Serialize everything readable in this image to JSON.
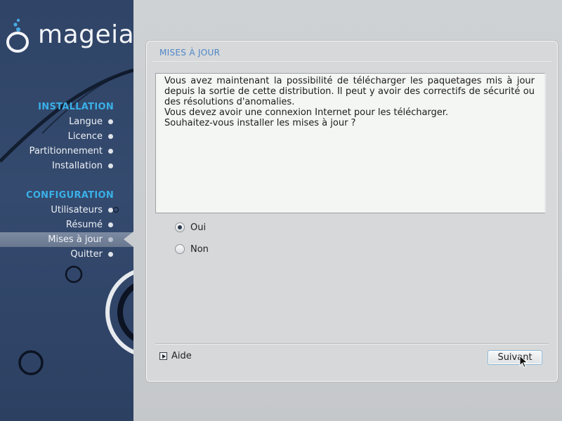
{
  "app": {
    "brand": "mageia"
  },
  "sidebar": {
    "sections": [
      {
        "title": "INSTALLATION",
        "items": [
          "Langue",
          "Licence",
          "Partitionnement",
          "Installation"
        ]
      },
      {
        "title": "CONFIGURATION",
        "items": [
          "Utilisateurs",
          "Résumé",
          "Mises à jour",
          "Quitter"
        ]
      }
    ],
    "active_item": "Mises à jour"
  },
  "panel": {
    "title": "MISES À JOUR",
    "message_lines": [
      "Vous avez maintenant la possibilité de télécharger les paquetages mis à jour depuis la sortie de cette distribution. Il peut y avoir des correctifs de sécurité ou des résolutions d'anomalies.",
      "Vous devez avoir une connexion Internet pour les télécharger.",
      "Souhaitez-vous installer les mises à jour ?"
    ],
    "options": [
      {
        "label": "Oui",
        "selected": true
      },
      {
        "label": "Non",
        "selected": false
      }
    ],
    "help_label": "Aide",
    "next_label": "Suivant"
  },
  "colors": {
    "sidebar_bg": "#31476b",
    "section_title": "#3ab0e8",
    "panel_title": "#4f86c6",
    "button_border": "#8bb8d6"
  },
  "icons": {
    "help": "triangle-right-icon",
    "cursor": "mouse-pointer-icon",
    "logo": "mageia-cauldron-icon"
  }
}
